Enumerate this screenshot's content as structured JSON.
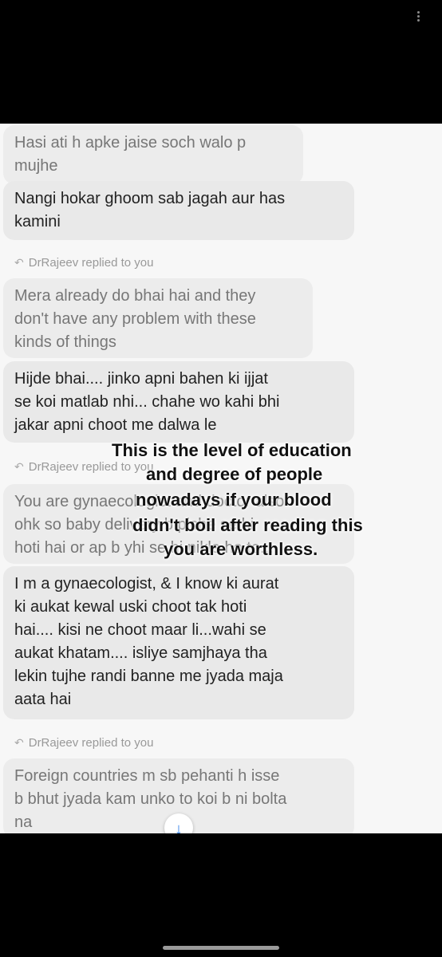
{
  "messages": [
    {
      "text": "Hasi ati h apke jaise soch walo p\nmujhe",
      "quoted": true
    },
    {
      "text": "Nangi hokar ghoom sab jagah aur has\nkamini",
      "quoted": false
    },
    {
      "text": "Mera already do bhai hai and they\ndon't have any problem with these\nkinds of things",
      "quoted": true
    },
    {
      "text": "Hijde bhai.... jinko apni bahen ki ijjat\nse koi matlab nhi... chahe wo kahi bhi\njakar apni choot me dalwa le",
      "quoted": false
    },
    {
      "text": "You are gynaecologist and doctor also\nohk so baby delivery b piche se hi\nhoti hai or ap b yhi se hi nikle ho to...",
      "quoted": true
    },
    {
      "text": "I m a gynaecologist, & I know ki aurat\nki aukat kewal uski choot tak hoti\nhai.... kisi ne choot maar li...wahi se\naukat khatam.... isliye samjhaya tha\nlekin tujhe randi banne me jyada maja\naata hai",
      "quoted": false
    },
    {
      "text": "Foreign countries m sb pehanti h isse\nb bhut jyada kam unko to koi b ni bolta\nna",
      "quoted": true
    }
  ],
  "reply_tag": "DrRajeev replied to you",
  "overlay_lines": [
    "This is the level of education",
    "and degree of people",
    "nowadays if your blood",
    "didn't boil after reading this",
    "you are worthless."
  ],
  "icons": {
    "reply": "reply-arrow-icon",
    "scroll": "arrow-down-icon",
    "menu": "more-vertical-icon"
  }
}
